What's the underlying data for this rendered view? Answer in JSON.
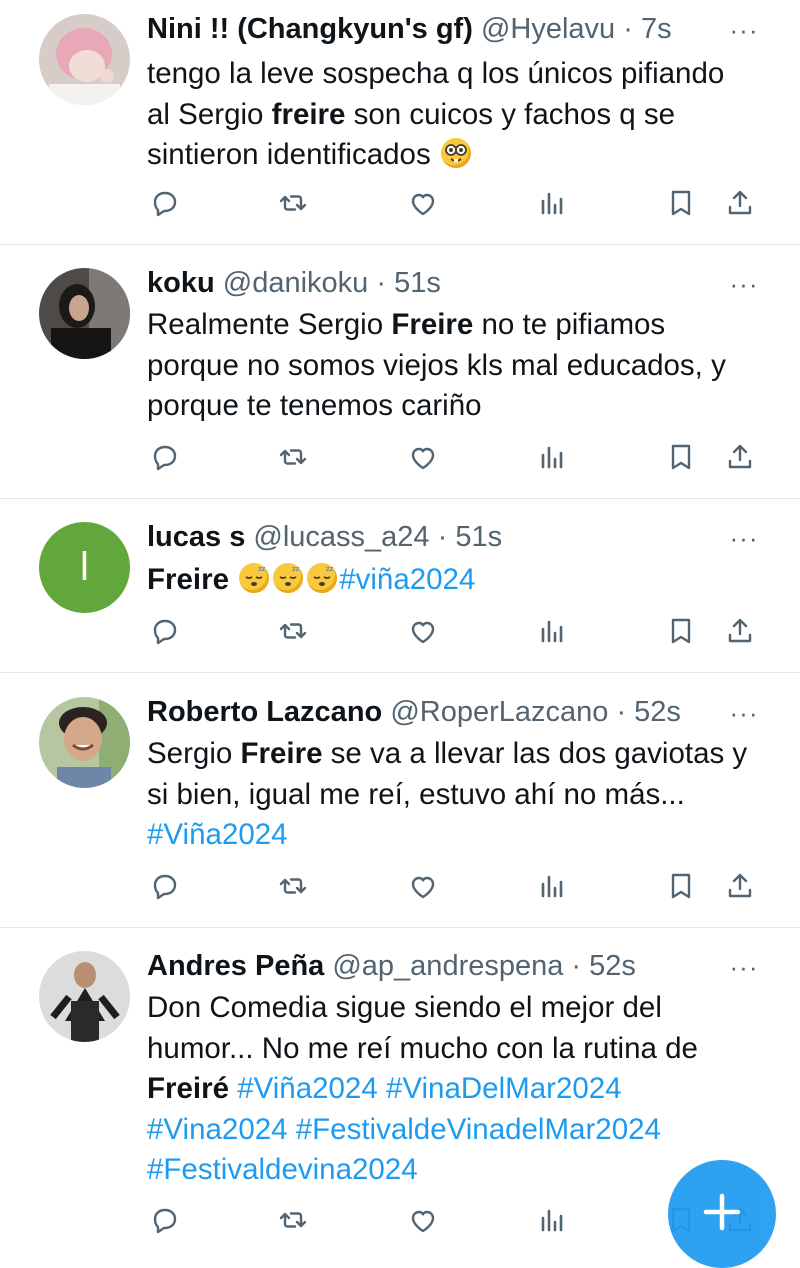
{
  "tweets": [
    {
      "name": "Nini !! (Changkyun's gf)",
      "handle": "@Hyelavu",
      "time": "7s",
      "lines": [
        [
          {
            "t": "tengo la leve sospecha q los únicos pifiando"
          }
        ],
        [
          {
            "t": "al Sergio "
          },
          {
            "t": "freire",
            "b": true
          },
          {
            "t": " son cuicos y fachos q se"
          }
        ],
        [
          {
            "t": "sintieron identificados "
          },
          {
            "emoji": "nerd-face"
          }
        ]
      ]
    },
    {
      "name": "koku",
      "handle": "@danikoku",
      "time": "51s",
      "lines": [
        [
          {
            "t": "Realmente Sergio "
          },
          {
            "t": "Freire",
            "b": true
          },
          {
            "t": " no te pifiamos"
          }
        ],
        [
          {
            "t": "porque no somos viejos kls mal educados, y"
          }
        ],
        [
          {
            "t": "porque te tenemos cariño"
          }
        ]
      ]
    },
    {
      "name": "lucas s",
      "handle": "@lucass_a24",
      "time": "51s",
      "avatar_letter": "l",
      "avatar_color": "#62a73b",
      "lines": [
        [
          {
            "t": "Freire",
            "b": true
          },
          {
            "t": " "
          },
          {
            "emoji": "sleeping-face"
          },
          {
            "emoji": "sleeping-face"
          },
          {
            "emoji": "sleeping-face"
          },
          {
            "t": "#viña2024",
            "tag": true
          }
        ]
      ]
    },
    {
      "name": "Roberto Lazcano",
      "handle": "@RoperLazcano",
      "time": "52s",
      "lines": [
        [
          {
            "t": "Sergio "
          },
          {
            "t": "Freire",
            "b": true
          },
          {
            "t": " se va a llevar las dos gaviotas y"
          }
        ],
        [
          {
            "t": "si bien, igual me reí, estuvo ahí no más..."
          }
        ],
        [
          {
            "t": "#Viña2024",
            "tag": true
          }
        ]
      ]
    },
    {
      "name": "Andres Peña",
      "handle": "@ap_andrespena",
      "time": "52s",
      "lines": [
        [
          {
            "t": "Don Comedia sigue siendo el mejor del"
          }
        ],
        [
          {
            "t": "humor... No me reí mucho con la rutina de"
          }
        ],
        [
          {
            "t": "Freiré",
            "b": true
          },
          {
            "t": " "
          },
          {
            "t": "#Viña2024",
            "tag": true
          },
          {
            "t": " "
          },
          {
            "t": "#VinaDelMar2024",
            "tag": true
          }
        ],
        [
          {
            "t": "#Vina2024",
            "tag": true
          },
          {
            "t": " "
          },
          {
            "t": "#FestivaldeVinadelMar2024",
            "tag": true
          }
        ],
        [
          {
            "t": "#Festivaldevina2024",
            "tag": true
          }
        ]
      ]
    }
  ],
  "meta_separator": " · ",
  "more_label": "···",
  "colors": {
    "accent": "#1d9bf0",
    "text": "#0f1419",
    "muted": "#536471"
  }
}
